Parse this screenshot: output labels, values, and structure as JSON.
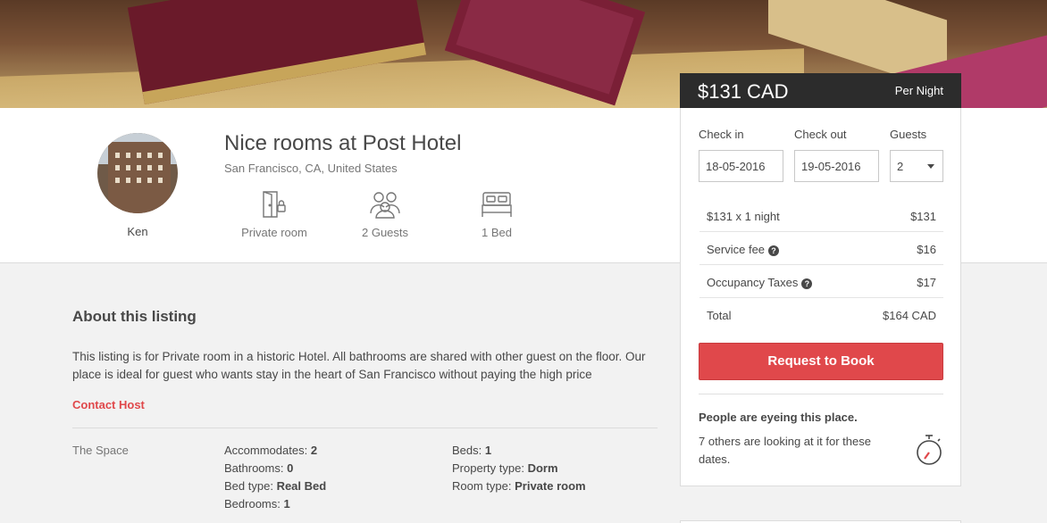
{
  "listing": {
    "title": "Nice rooms at Post Hotel",
    "location": "San Francisco, CA, United States",
    "host_name": "Ken",
    "amenities": [
      {
        "icon": "door-lock-icon",
        "label": "Private room"
      },
      {
        "icon": "guests-icon",
        "label": "2 Guests"
      },
      {
        "icon": "bed-icon",
        "label": "1 Bed"
      }
    ]
  },
  "booking": {
    "price": "$131 CAD",
    "per": "Per Night",
    "check_in_label": "Check in",
    "check_out_label": "Check out",
    "guests_label": "Guests",
    "check_in_value": "18-05-2016",
    "check_out_value": "19-05-2016",
    "guests_value": "2",
    "rows": [
      {
        "label": "$131 x 1 night",
        "value": "$131",
        "help": false
      },
      {
        "label": "Service fee",
        "value": "$16",
        "help": true
      },
      {
        "label": "Occupancy Taxes",
        "value": "$17",
        "help": true
      },
      {
        "label": "Total",
        "value": "$164 CAD",
        "help": false
      }
    ],
    "button_label": "Request to Book",
    "eye_title": "People are eyeing this place.",
    "eye_text": "7 others are looking at it for these dates."
  },
  "about": {
    "title": "About this listing",
    "description": "This listing is for Private room in a historic Hotel. All bathrooms are shared with other guest on the floor. Our place is ideal for guest who wants stay in the heart of San Francisco without paying the high price",
    "contact_label": "Contact Host",
    "space_label": "The Space",
    "specs": [
      {
        "key": "Accommodates:",
        "value": "2"
      },
      {
        "key": "Bathrooms:",
        "value": "0"
      },
      {
        "key": "Bed type:",
        "value": "Real Bed"
      },
      {
        "key": "Bedrooms:",
        "value": "1"
      },
      {
        "key": "Beds:",
        "value": "1"
      },
      {
        "key": "Property type:",
        "value": "Dorm"
      },
      {
        "key": "Room type:",
        "value": "Private room"
      }
    ]
  },
  "colors": {
    "accent": "#e0484b",
    "header_bar": "#2c2c2c"
  }
}
